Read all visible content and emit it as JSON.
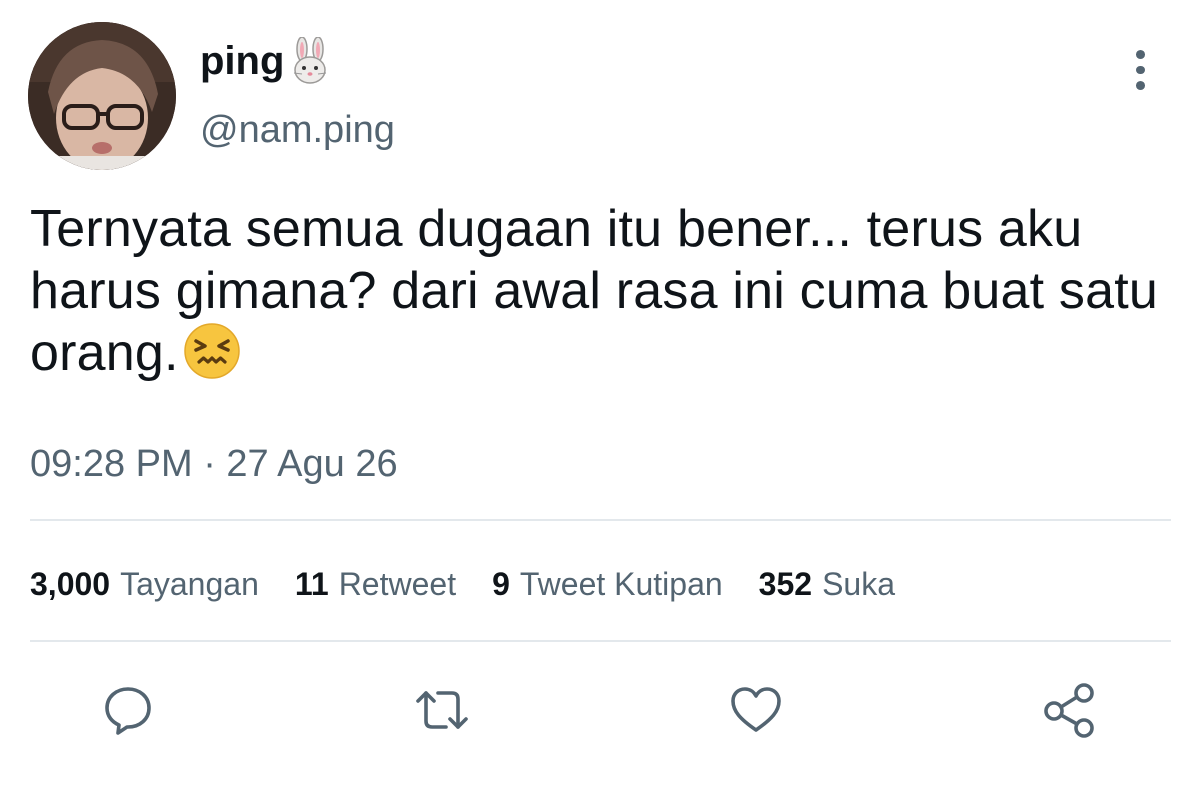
{
  "author": {
    "display_name": "ping",
    "name_emoji": "rabbit-face-icon",
    "handle": "@nam.ping"
  },
  "tweet": {
    "text": "Ternyata semua dugaan itu bener... terus aku harus gimana? dari awal rasa ini cuma buat satu orang.",
    "trailing_emoji": "confounded-face-icon",
    "timestamp": "09:28 PM · 27 Agu 26"
  },
  "stats": [
    {
      "count": "3,000",
      "label": "Tayangan"
    },
    {
      "count": "11",
      "label": "Retweet"
    },
    {
      "count": "9",
      "label": "Tweet Kutipan"
    },
    {
      "count": "352",
      "label": "Suka"
    }
  ],
  "actions": [
    "reply-icon",
    "retweet-icon",
    "like-icon",
    "share-icon"
  ],
  "colors": {
    "text_primary": "#0f1419",
    "text_secondary": "#536471",
    "divider": "#e3e8ec",
    "emoji_yellow": "#f7c53f"
  }
}
